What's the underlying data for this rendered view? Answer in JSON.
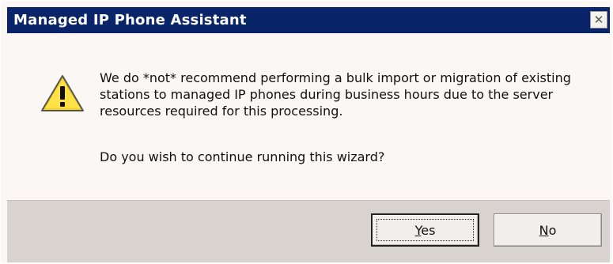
{
  "dialog": {
    "title": "Managed IP Phone Assistant",
    "close_glyph": "✕",
    "message": "We do *not* recommend performing a bulk import or migration of existing stations to managed IP phones during business hours due to the server resources required for this processing.",
    "question": "Do you wish to continue running this wizard?",
    "icon": "warning-icon",
    "buttons": {
      "yes_label": "Yes",
      "no_label": "No"
    }
  }
}
